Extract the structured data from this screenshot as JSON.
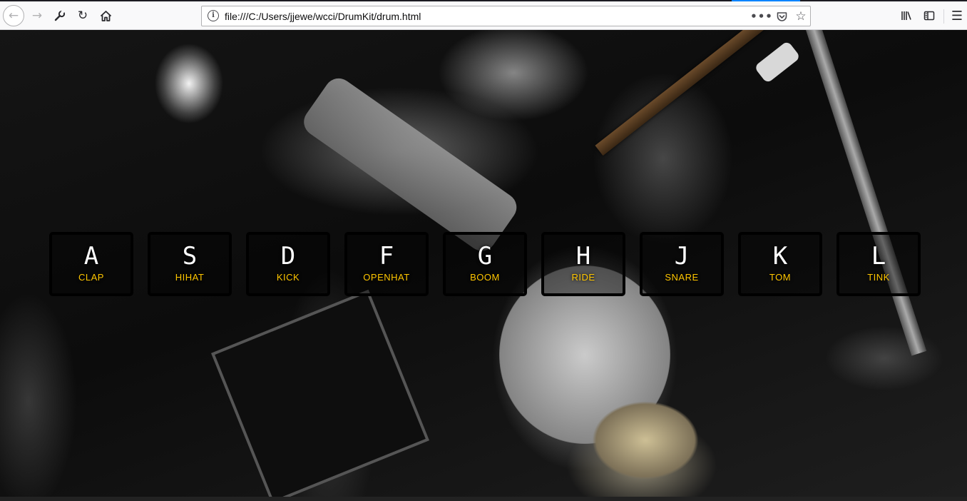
{
  "browser": {
    "url": "file:///C:/Users/jjewe/wcci/DrumKit/drum.html",
    "icons": {
      "back": "back-arrow-icon",
      "forward": "forward-arrow-icon",
      "wrench": "wrench-icon",
      "reload": "reload-icon",
      "home": "home-icon",
      "info": "info-icon",
      "more": "more-icon",
      "pocket": "pocket-icon",
      "star": "star-icon",
      "library": "library-icon",
      "sidebar": "sidebar-icon",
      "menu": "hamburger-menu-icon"
    },
    "accent_color": "#0a84ff"
  },
  "drumkit": {
    "key_color": "#ffffff",
    "sound_color": "#ffc600",
    "keys": [
      {
        "key": "A",
        "sound": "CLAP"
      },
      {
        "key": "S",
        "sound": "HIHAT"
      },
      {
        "key": "D",
        "sound": "KICK"
      },
      {
        "key": "F",
        "sound": "OPENHAT"
      },
      {
        "key": "G",
        "sound": "BOOM"
      },
      {
        "key": "H",
        "sound": "RIDE"
      },
      {
        "key": "J",
        "sound": "SNARE"
      },
      {
        "key": "K",
        "sound": "TOM"
      },
      {
        "key": "L",
        "sound": "TINK"
      }
    ]
  }
}
